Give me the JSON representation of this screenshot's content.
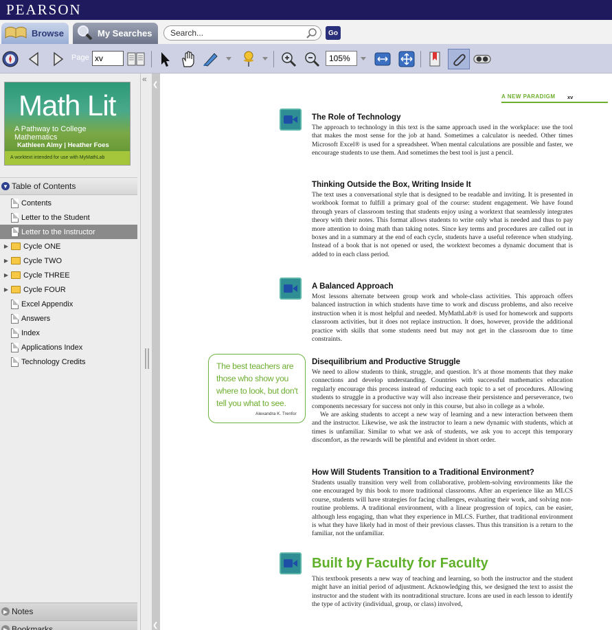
{
  "header": {
    "logo": "PEARSON"
  },
  "tabs": [
    {
      "label": "Browse"
    },
    {
      "label": "My Searches"
    }
  ],
  "search": {
    "placeholder": "Search...",
    "go_label": "Go"
  },
  "toolbar": {
    "page_label": "Page",
    "page_value": "xv",
    "zoom_value": "105%"
  },
  "cover": {
    "title": "Math Lit",
    "subtitle": "A Pathway to College Mathematics",
    "authors": "Kathleen Almy  |  Heather Foes",
    "band_text": "A worktext intended for use with MyMathLab"
  },
  "sidebar": {
    "toc_header": "Table of Contents",
    "toc_items": [
      {
        "label": "Contents"
      },
      {
        "label": "Letter to the Student"
      },
      {
        "label": "Letter to the Instructor"
      },
      {
        "label": "Cycle ONE"
      },
      {
        "label": "Cycle TWO"
      },
      {
        "label": "Cycle THREE"
      },
      {
        "label": "Cycle FOUR"
      },
      {
        "label": "Excel Appendix"
      },
      {
        "label": "Answers"
      },
      {
        "label": "Index"
      },
      {
        "label": "Applications Index"
      },
      {
        "label": "Technology Credits"
      }
    ],
    "notes_header": "Notes",
    "bookmarks_header": "Bookmarks"
  },
  "page": {
    "running_head": "A NEW PARADIGM",
    "page_number": "xv",
    "sections": [
      {
        "heading": "The Role of Technology",
        "body": "The approach to technology in this text is the same approach used in the workplace: use the tool that makes the most sense for the job at hand. Sometimes a calculator is needed. Other times Microsoft Excel® is used for a spreadsheet. When mental calculations are possible and faster, we encourage students to use them. And sometimes the best tool is just a pencil."
      },
      {
        "heading": "Thinking Outside the Box, Writing Inside It",
        "body": "The text uses a conversational style that is designed to be readable and inviting. It is presented in workbook format to fulfill a primary goal of the course: student engagement. We have found through years of classroom testing that students enjoy using a worktext that seamlessly integrates theory with their notes. This format allows students to write only what is needed and thus to pay more attention to doing math than taking notes. Since key terms and procedures are called out in boxes and in a summary at the end of each cycle, students have a useful reference when studying. Instead of a book that is not opened or used, the worktext becomes a dynamic document that is added to in each class period."
      },
      {
        "heading": "A Balanced Approach",
        "body": "Most lessons alternate between group work and whole-class activities. This approach offers balanced instruction in which students have time to work and discuss problems, and also receive instruction when it is most helpful and needed. MyMathLab® is used for homework and supports classroom activities, but it does not replace instruction. It does, however, provide the additional practice with skills that some students need but may not get in the classroom due to time constraints."
      },
      {
        "heading": "Disequilibrium and Productive Struggle",
        "body": "We need to allow students to think, struggle, and question. It’s at those moments that they make connections and develop understanding. Countries with successful mathematics education regularly encourage this process instead of reducing each topic to a set of procedures. Allowing students to struggle in a productive way will also increase their persistence and perseverance, two components necessary for success not only in this course, but also in college as a whole.",
        "body2": "We are asking students to accept a new way of learning and a new interaction between them and the instructor. Likewise, we ask the instructor to learn a new dynamic with students, which at times is unfamiliar. Similar to what we ask of students, we ask you to accept this temporary discomfort, as the rewards will be plentiful and evident in short order."
      },
      {
        "heading": "How Will Students Transition to a Traditional Environment?",
        "body": "Students usually transition very well from collaborative, problem-solving environments like the one encouraged by this book to more traditional classrooms. After an experience like an MLCS course, students will have strategies for facing challenges, evaluating their work, and solving non-routine problems. A traditional environment, with a linear progression of topics, can be easier, although less engaging, than what they experience in MLCS. Further, that traditional environment is what they have likely had in most of their previous classes. Thus this transition is a return to the familiar, not the unfamiliar."
      }
    ],
    "big_heading": "Built by Faculty for Faculty",
    "big_body": "This textbook presents a new way of teaching and learning, so both the instructor and the student might have an initial period of adjustment. Acknowledging this, we designed the text to assist the instructor and the student with its nontraditional structure. Icons are used in each lesson to identify the type of activity (individual, group, or class) involved,",
    "quote": {
      "text": "The best teachers are those who show you where to look, but don't tell you what to see.",
      "author": "Alexandra K. Trenfor"
    }
  },
  "colors": {
    "brand": "#1f1a5e",
    "accent_green": "#6cae2e",
    "video_icon": "#2f8e94"
  }
}
